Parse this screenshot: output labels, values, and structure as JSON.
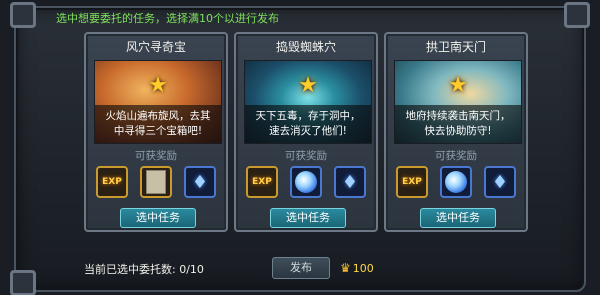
{
  "instruction": "选中想要委托的任务，选择满10个以进行发布",
  "reward_label": "可获奖励",
  "select_label": "选中任务",
  "cards": [
    {
      "title": "风穴寻奇宝",
      "desc": "火焰山遍布旋风，去其中寻得三个宝箱吧!",
      "image_icon": "desert-scene",
      "rewards": [
        {
          "icon": "exp-icon",
          "label": "EXP"
        },
        {
          "icon": "parchment-icon",
          "label": ""
        },
        {
          "icon": "blue-crystal-icon",
          "label": ""
        }
      ]
    },
    {
      "title": "捣毁蜘蛛穴",
      "desc": "天下五毒，存于洞中，速去消灭了他们!",
      "image_icon": "cave-scene",
      "rewards": [
        {
          "icon": "exp-icon",
          "label": "EXP"
        },
        {
          "icon": "light-orb-icon",
          "label": ""
        },
        {
          "icon": "blue-crystal-icon",
          "label": ""
        }
      ]
    },
    {
      "title": "拱卫南天门",
      "desc": "地府持续袭击南天门，快去协助防守!",
      "image_icon": "gate-scene",
      "rewards": [
        {
          "icon": "exp-icon",
          "label": "EXP"
        },
        {
          "icon": "light-orb-icon",
          "label": ""
        },
        {
          "icon": "blue-crystal-icon",
          "label": ""
        }
      ]
    }
  ],
  "selected_count_label": "当前已选中委托数: 0/10",
  "publish_label": "发布",
  "cost_value": "100",
  "colors": {
    "instruction_text": "#7fe05a",
    "star": "#ffcc2a",
    "button_teal": "#1a6676",
    "cost_gold": "#ffd84a"
  }
}
